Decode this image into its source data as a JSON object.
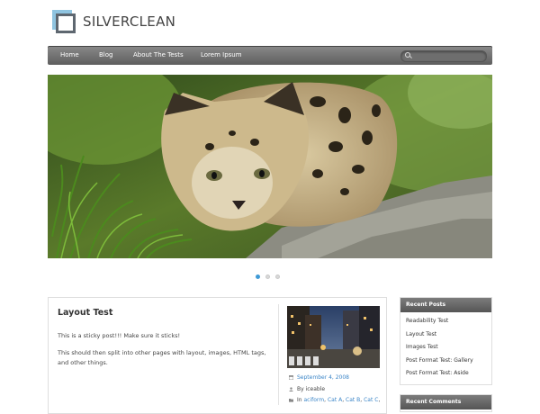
{
  "site": {
    "title": "SILVERCLEAN"
  },
  "nav": {
    "items": [
      {
        "label": "Home"
      },
      {
        "label": "Blog"
      },
      {
        "label": "About The Tests"
      },
      {
        "label": "Lorem Ipsum"
      }
    ],
    "search": {
      "placeholder": ""
    }
  },
  "slider": {
    "total": 3,
    "active": 1
  },
  "post": {
    "title": "Layout Test",
    "paragraphs": [
      "This is a sticky post!!! Make sure it sticks!",
      "This should then split into other pages with layout, images, HTML tags, and other things."
    ],
    "meta": {
      "date": "September 4, 2008",
      "author": "By iceable",
      "categories_prefix": "In",
      "categories": [
        "aciform",
        "Cat A",
        "Cat B",
        "Cat C"
      ]
    }
  },
  "sidebar": {
    "recent_posts": {
      "title": "Recent Posts",
      "items": [
        "Readability Test",
        "Layout Test",
        "Images Test",
        "Post Format Test: Gallery",
        "Post Format Test: Aside"
      ]
    },
    "recent_comments": {
      "title": "Recent Comments"
    }
  },
  "colors": {
    "accent": "#3c86c8",
    "nav": "#6e6e6e"
  }
}
